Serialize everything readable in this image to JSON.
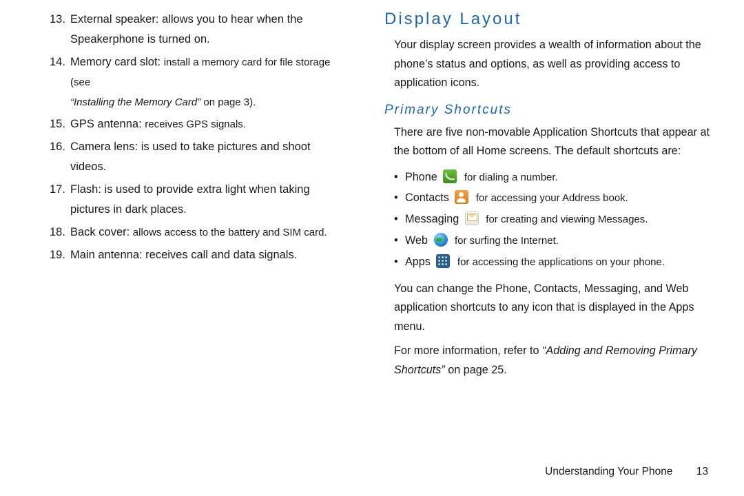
{
  "left": {
    "items": [
      {
        "num": "13.",
        "term": "External speaker",
        "sep": ": ",
        "desc": "allows you to hear when the Speakerphone is turned on."
      },
      {
        "num": "14.",
        "term": "Memory card slot",
        "sep": ": ",
        "desc": "install a memory card for file storage (see",
        "sub_italic": "“Installing the Memory Card”",
        "sub_after": " on page 3)."
      },
      {
        "num": "15.",
        "term": "GPS antenna",
        "sep": ": ",
        "desc": "receives GPS signals."
      },
      {
        "num": "16.",
        "term": "Camera lens",
        "sep": ": ",
        "desc": "is used to take pictures and shoot videos."
      },
      {
        "num": "17.",
        "term": "Flash",
        "sep": ": ",
        "desc": "is used to provide extra light when taking pictures in dark places."
      },
      {
        "num": "18.",
        "term": "Back cover",
        "sep": ": ",
        "desc": "allows access to the battery and SIM card."
      },
      {
        "num": "19.",
        "term": "Main antenna",
        "sep": ": ",
        "desc": "receives call and data signals."
      }
    ]
  },
  "right": {
    "heading": "Display Layout",
    "intro": "Your display screen provides a wealth of information about the phone’s status and options, as well as providing access to application icons.",
    "subheading": "Primary Shortcuts",
    "shortcuts_intro": "There are five non-movable Application Shortcuts that appear at the bottom of all Home screens. The default shortcuts are:",
    "shortcuts": [
      {
        "name": "Phone",
        "icon": "ico-phone",
        "after": "for dialing a number."
      },
      {
        "name": "Contacts",
        "icon": "ico-contacts",
        "after": "for accessing your Address book."
      },
      {
        "name": "Messaging",
        "icon": "ico-messaging",
        "after": "for creating and viewing Messages."
      },
      {
        "name": "Web",
        "icon": "ico-web",
        "after": "for surfing the Internet."
      },
      {
        "name": "Apps",
        "icon": "ico-apps",
        "after": "for accessing the applications on your phone."
      }
    ],
    "after_list": "You can change the Phone, Contacts, Messaging, and Web application shortcuts to any icon that is displayed in the Apps menu.",
    "ref_before": "For more information, refer to ",
    "ref_italic": "“Adding and Removing Primary Shortcuts”",
    "ref_after": "  on page 25."
  },
  "footer": {
    "chapter": "Understanding Your Phone",
    "page": "13"
  }
}
